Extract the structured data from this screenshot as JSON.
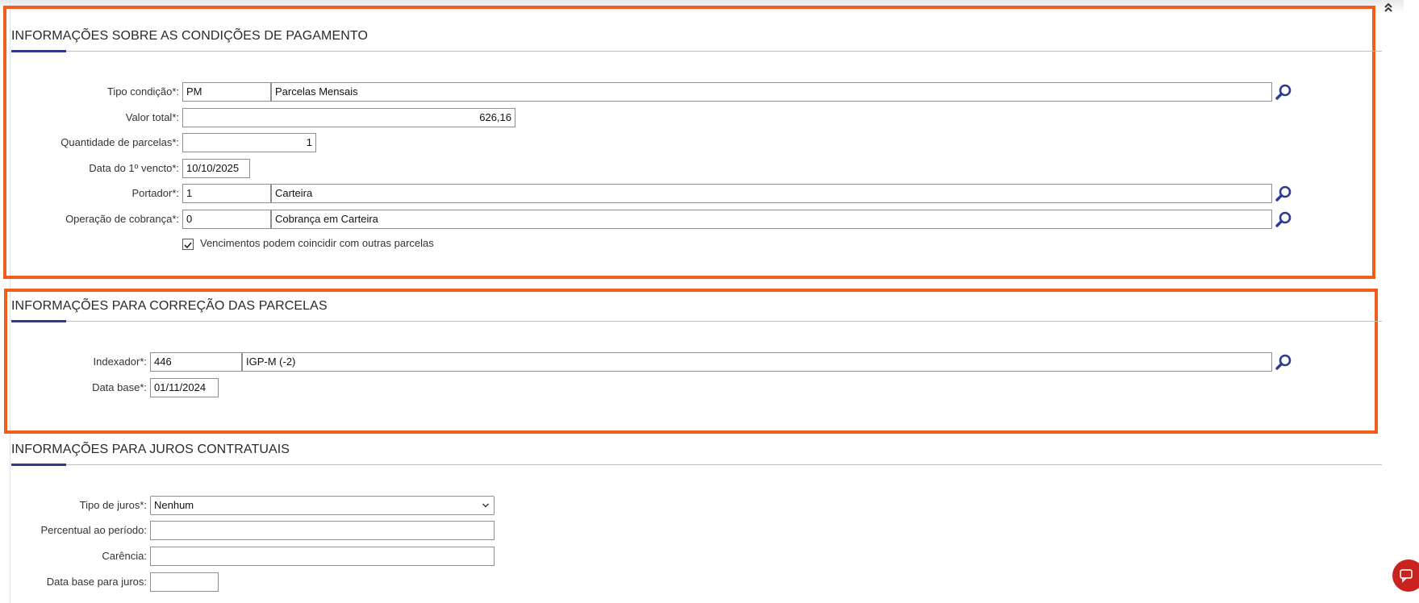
{
  "sections": {
    "pagamento": {
      "title": "INFORMAÇÕES SOBRE AS CONDIÇÕES DE PAGAMENTO",
      "tipo_condicao": {
        "label": "Tipo condição*:",
        "code": "PM",
        "desc": "Parcelas Mensais"
      },
      "valor_total": {
        "label": "Valor total*:",
        "value": "626,16"
      },
      "qtd_parcelas": {
        "label": "Quantidade de parcelas*:",
        "value": "1"
      },
      "data_vencto": {
        "label": "Data do 1º vencto*:",
        "value": "10/10/2025"
      },
      "portador": {
        "label": "Portador*:",
        "code": "1",
        "desc": "Carteira"
      },
      "operacao_cobranca": {
        "label": "Operação de cobrança*:",
        "code": "0",
        "desc": "Cobrança em Carteira"
      },
      "vencimentos_checkbox": {
        "label": "Vencimentos podem coincidir com outras parcelas",
        "checked": true
      }
    },
    "correcao": {
      "title": "INFORMAÇÕES PARA CORREÇÃO DAS PARCELAS",
      "indexador": {
        "label": "Indexador*:",
        "code": "446",
        "desc": "IGP-M (-2)"
      },
      "data_base": {
        "label": "Data base*:",
        "value": "01/11/2024"
      }
    },
    "juros": {
      "title": "INFORMAÇÕES PARA JUROS CONTRATUAIS",
      "tipo_juros": {
        "label": "Tipo de juros*:",
        "value": "Nenhum"
      },
      "percentual": {
        "label": "Percentual ao período:",
        "value": ""
      },
      "carencia": {
        "label": "Carência:",
        "value": ""
      },
      "data_base_juros": {
        "label": "Data base para juros:",
        "value": ""
      }
    }
  },
  "colors": {
    "highlight": "#f25d1b",
    "accent": "#2b3b90",
    "chat_button": "#c9221f"
  },
  "icons": {
    "collapse": "double-chevron-up-icon",
    "search": "magnifier-icon",
    "select": "chevron-down-icon",
    "checkbox": "checkmark-icon",
    "chat": "chat-bubble-icon"
  }
}
